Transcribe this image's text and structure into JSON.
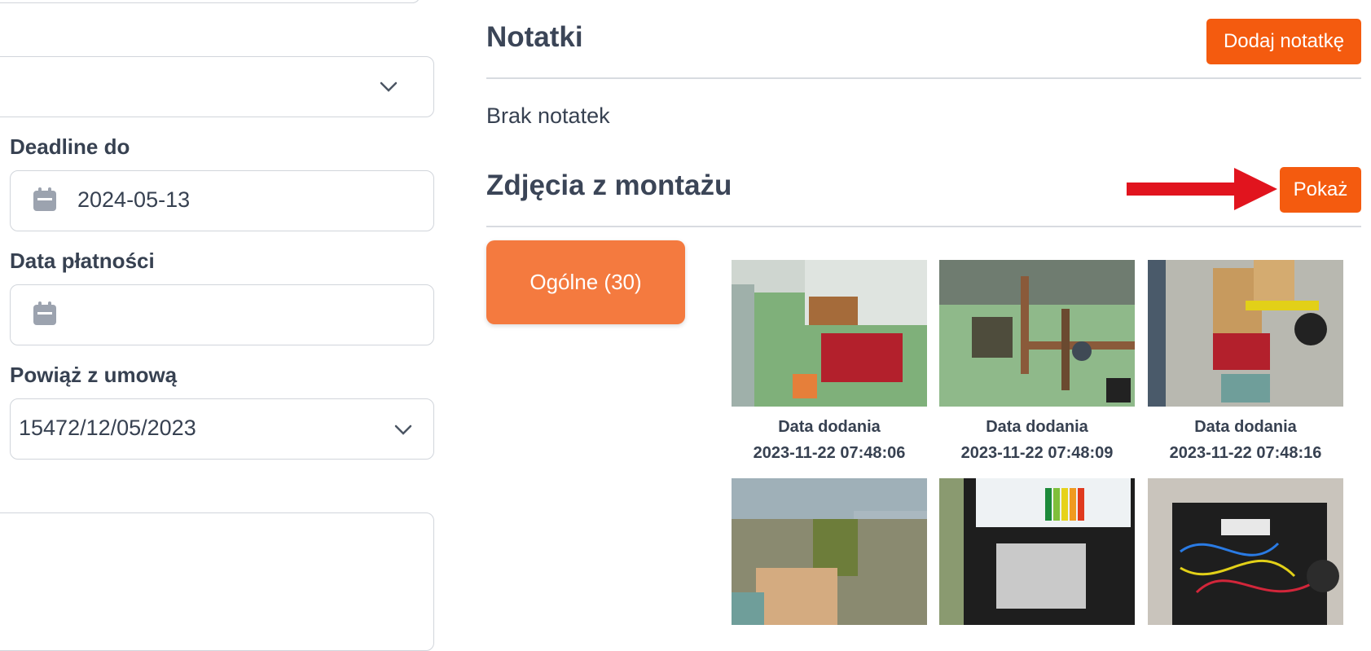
{
  "form": {
    "deadline_label": "Deadline do",
    "deadline_value": "2024-05-13",
    "payment_date_label": "Data płatności",
    "payment_date_value": "",
    "contract_label": "Powiąż z umową",
    "contract_value": "15472/12/05/2023"
  },
  "notes": {
    "title": "Notatki",
    "add_button": "Dodaj notatkę",
    "empty_text": "Brak notatek"
  },
  "photos": {
    "title": "Zdjęcia z montażu",
    "show_button": "Pokaż",
    "category_tab": "Ogólne (30)",
    "items": [
      {
        "caption_label": "Data dodania",
        "date": "2023-11-22 07:48:06"
      },
      {
        "caption_label": "Data dodania",
        "date": "2023-11-22 07:48:09"
      },
      {
        "caption_label": "Data dodania",
        "date": "2023-11-22 07:48:16"
      },
      {
        "caption_label": "",
        "date": ""
      },
      {
        "caption_label": "",
        "date": ""
      },
      {
        "caption_label": "",
        "date": ""
      }
    ]
  },
  "colors": {
    "accent_orange": "#f45b0f",
    "tab_orange": "#f47a3f",
    "arrow_red": "#e1141e"
  }
}
